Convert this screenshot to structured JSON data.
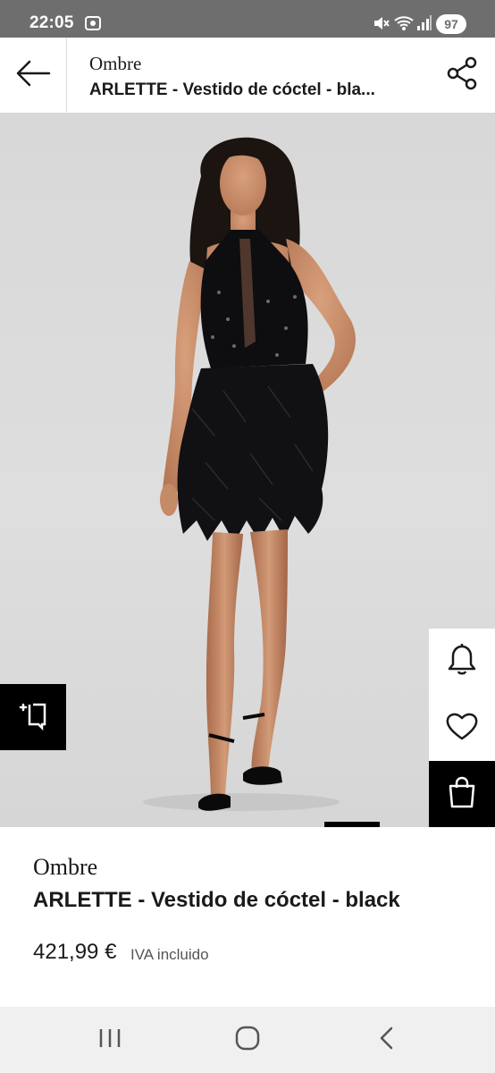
{
  "status_bar": {
    "time": "22:05",
    "battery": "97",
    "icons": [
      "screenshot-icon",
      "mute-icon",
      "wifi-icon",
      "signal-icon"
    ]
  },
  "header": {
    "brand": "Ombre",
    "title": "ARLETTE  - Vestido de cóctel - bla...",
    "back_icon": "arrow-left-icon",
    "share_icon": "share-icon"
  },
  "product_image": {
    "description_icons": [
      "compare-icon",
      "bell-icon",
      "heart-icon",
      "bag-icon"
    ]
  },
  "product": {
    "brand": "Ombre",
    "title": "ARLETTE  - Vestido de cóctel - black",
    "price": "421,99 €",
    "tax_note": "IVA incluido"
  },
  "colors": {
    "status_bar": "#6e6e6e",
    "accent": "#000000",
    "background": "#ffffff",
    "hero_bg": "#dcdcdc"
  },
  "nav_bar": {
    "icons": [
      "recent-apps-icon",
      "home-icon",
      "back-icon"
    ]
  }
}
